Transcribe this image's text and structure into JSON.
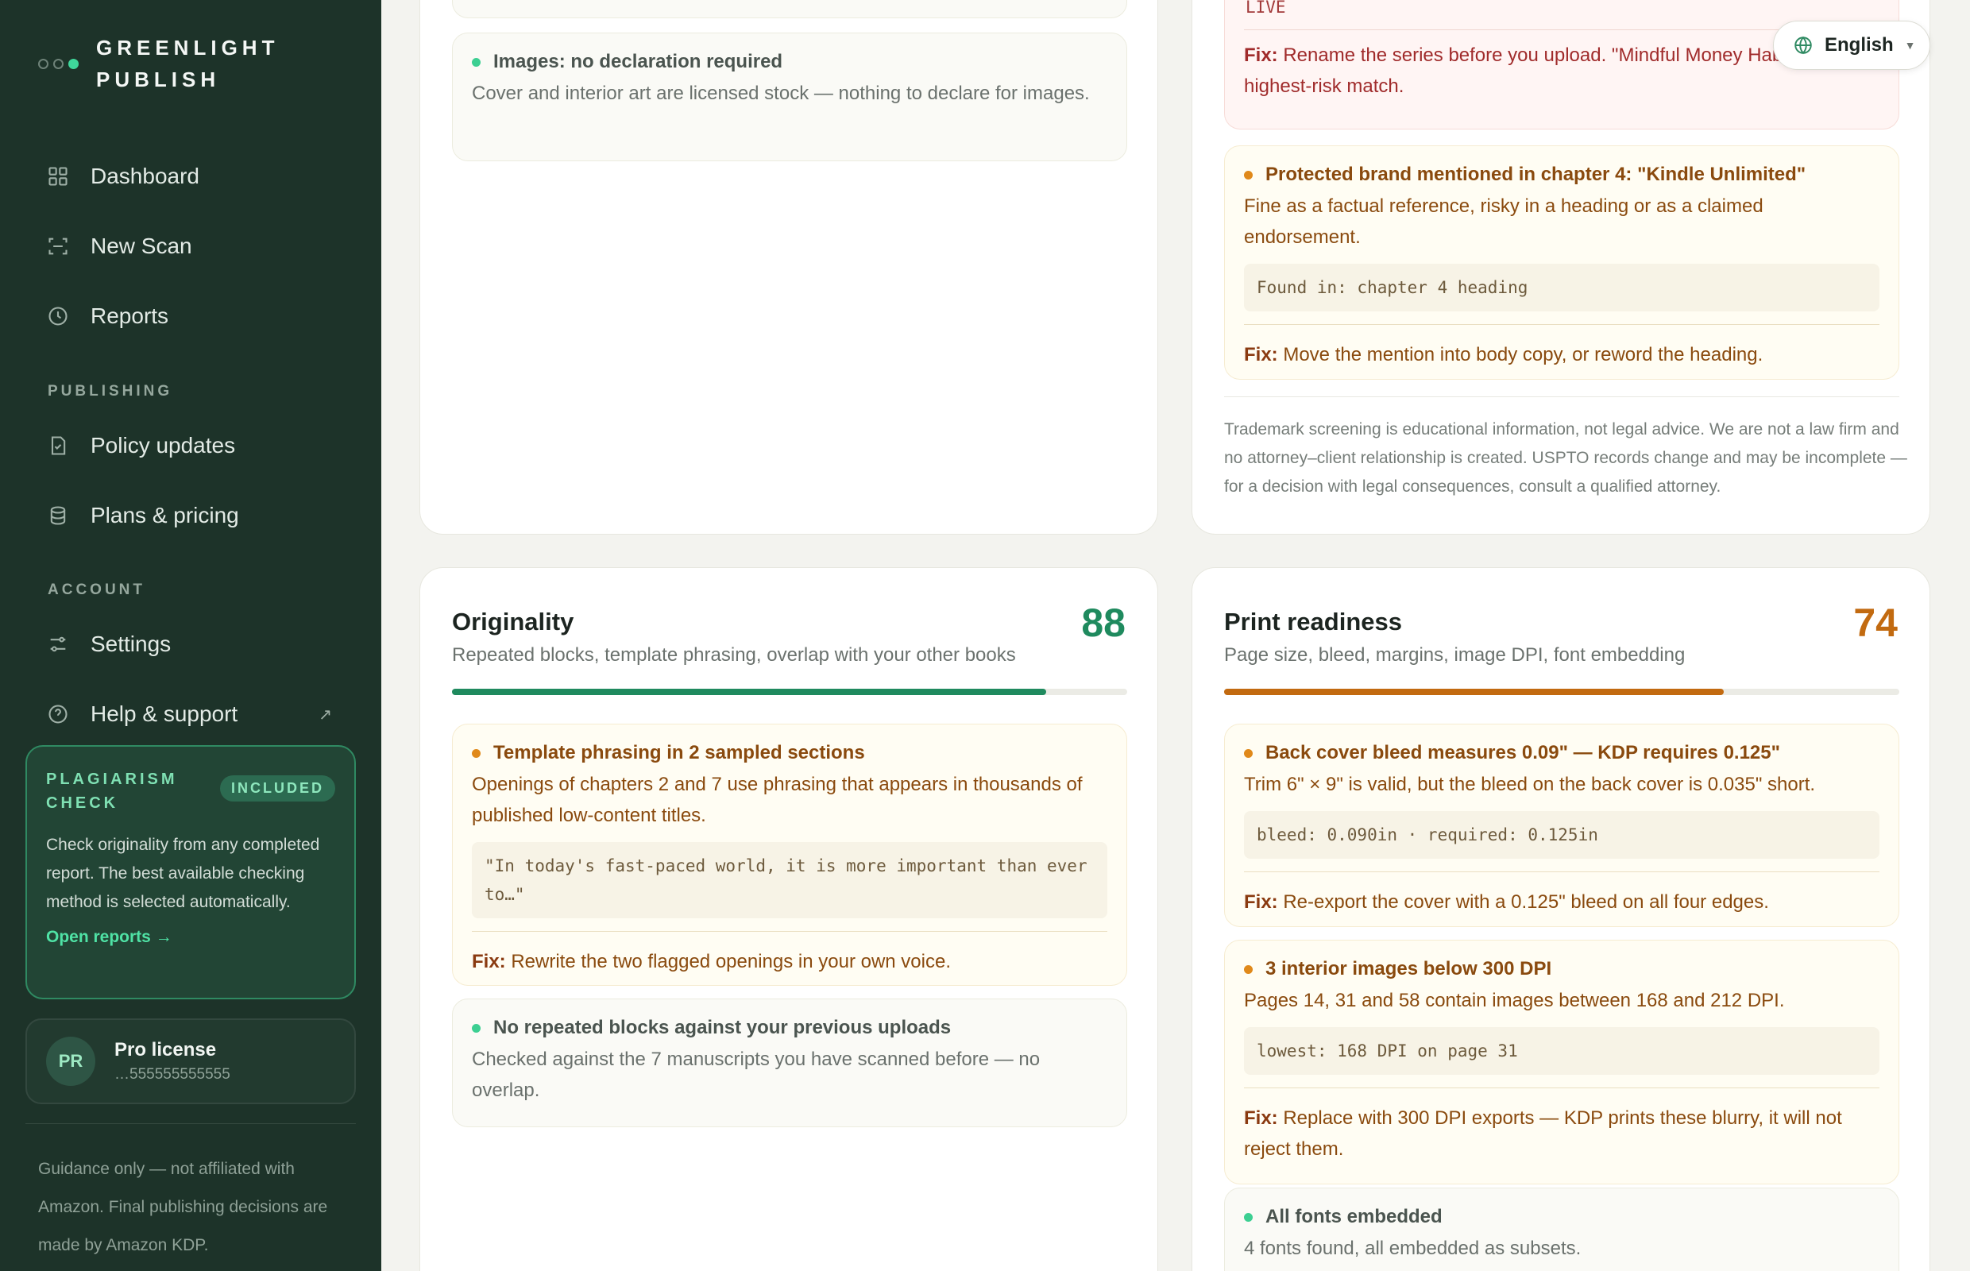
{
  "brand": {
    "name": "GREENLIGHT PUBLISH"
  },
  "nav": {
    "dashboard": "Dashboard",
    "new_scan": "New Scan",
    "reports": "Reports",
    "section_publishing": "PUBLISHING",
    "policy_updates": "Policy updates",
    "plans_pricing": "Plans & pricing",
    "section_account": "ACCOUNT",
    "settings": "Settings",
    "help_support": "Help & support"
  },
  "plagiarism": {
    "title": "PLAGIARISM CHECK",
    "badge": "INCLUDED",
    "body": "Check originality from any completed report. The best available checking method is selected automatically.",
    "link": "Open reports →"
  },
  "license": {
    "initials": "PR",
    "name": "Pro license",
    "key": "…555555555555"
  },
  "sidebar_footer": "Guidance only — not affiliated with Amazon. Final publishing decisions are made by Amazon KDP.",
  "language": {
    "label": "English"
  },
  "images_card": {
    "ok_title": "Images: no declaration required",
    "ok_desc": "Cover and interior art are licensed stock — nothing to declare for images."
  },
  "trademark_card": {
    "live_code": "LIVE",
    "fix_label": "Fix:",
    "series_fix": "Rename the series before you upload. \"Mindful Money Habits\" is the highest-risk match.",
    "brand_title": "Protected brand mentioned in chapter 4: \"Kindle Unlimited\"",
    "brand_desc": "Fine as a factual reference, risky in a heading or as a claimed endorsement.",
    "brand_code": "Found in: chapter 4 heading",
    "brand_fix": "Move the mention into body copy, or reword the heading.",
    "disclaimer": "Trademark screening is educational information, not legal advice. We are not a law firm and no attorney–client relationship is created. USPTO records change and may be incomplete — for a decision with legal consequences, consult a qualified attorney."
  },
  "originality": {
    "title": "Originality",
    "subtitle": "Repeated blocks, template phrasing, overlap with your other books",
    "score": "88",
    "score_value": 88,
    "color": "#1f8a5e",
    "warn_title": "Template phrasing in 2 sampled sections",
    "warn_desc": "Openings of chapters 2 and 7 use phrasing that appears in thousands of published low-content titles.",
    "warn_code": "\"In today's fast-paced world, it is more important than ever to…\"",
    "fix_label": "Fix:",
    "warn_fix": "Rewrite the two flagged openings in your own voice.",
    "ok_title": "No repeated blocks against your previous uploads",
    "ok_desc": "Checked against the 7 manuscripts you have scanned before — no overlap."
  },
  "print": {
    "title": "Print readiness",
    "subtitle": "Page size, bleed, margins, image DPI, font embedding",
    "score": "74",
    "score_value": 74,
    "color": "#c26a10",
    "bleed_title": "Back cover bleed measures 0.09\" — KDP requires 0.125\"",
    "bleed_desc": "Trim 6\" × 9\" is valid, but the bleed on the back cover is 0.035\" short.",
    "bleed_code": "bleed: 0.090in · required: 0.125in",
    "fix_label": "Fix:",
    "bleed_fix": "Re-export the cover with a 0.125\" bleed on all four edges.",
    "dpi_title": "3 interior images below 300 DPI",
    "dpi_desc": "Pages 14, 31 and 58 contain images between 168 and 212 DPI.",
    "dpi_code": "lowest: 168 DPI on page 31",
    "dpi_fix": "Replace with 300 DPI exports — KDP prints these blurry, it will not reject them.",
    "fonts_title": "All fonts embedded",
    "fonts_desc": "4 fonts found, all embedded as subsets."
  }
}
